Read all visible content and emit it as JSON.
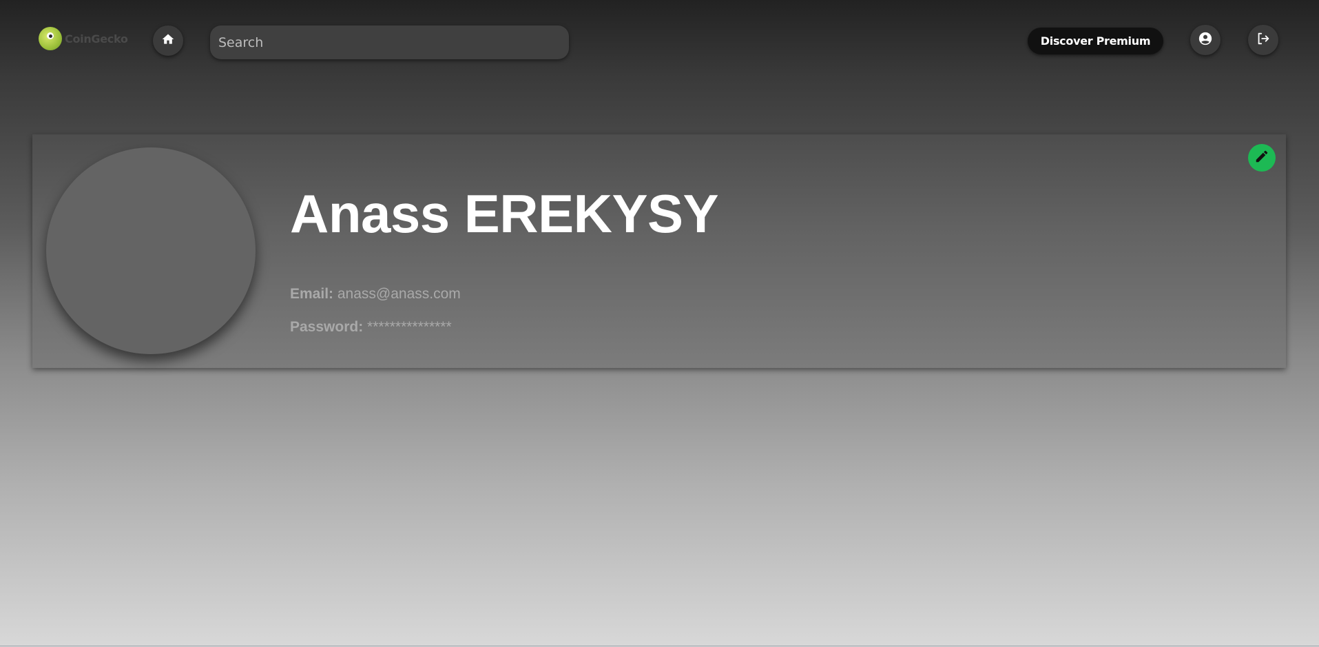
{
  "header": {
    "logo_text": "CoinGecko",
    "search_placeholder": "Search",
    "premium_label": "Discover Premium",
    "icons": [
      "home-icon",
      "account-circle-icon",
      "logout-icon"
    ]
  },
  "profile": {
    "name": "Anass EREKYSY",
    "email_label": "Email:",
    "email_value": "anass@anass.com",
    "password_label": "Password:",
    "password_value": "***************",
    "edit_icon": "pencil-icon"
  },
  "colors": {
    "accent_green": "#1db954",
    "premium_bg": "#111111",
    "card_top": "#4d4d4d",
    "card_bottom": "#7c7c7c"
  }
}
